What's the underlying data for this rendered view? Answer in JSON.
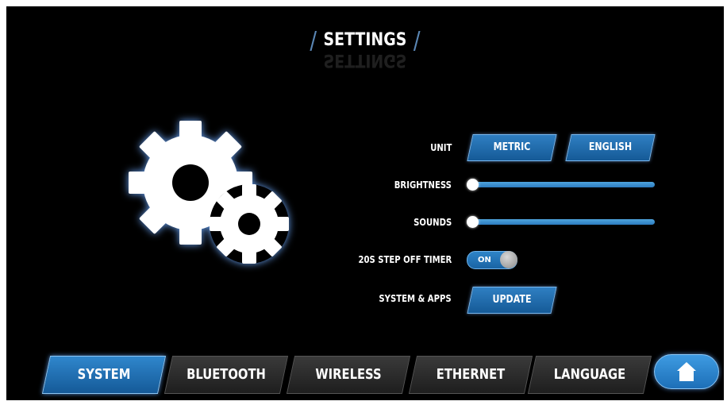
{
  "header": {
    "title": "SETTINGS"
  },
  "settings": {
    "unit": {
      "label": "UNIT",
      "options": [
        "METRIC",
        "ENGLISH"
      ],
      "selected": "METRIC"
    },
    "brightness": {
      "label": "BRIGHTNESS",
      "value": 0
    },
    "sounds": {
      "label": "SOUNDS",
      "value": 0
    },
    "step_off_timer": {
      "label": "20S STEP OFF TIMER",
      "state": "ON"
    },
    "system_apps": {
      "label": "SYSTEM & APPS",
      "button": "UPDATE"
    }
  },
  "tabs": [
    {
      "label": "SYSTEM",
      "active": true
    },
    {
      "label": "BLUETOOTH",
      "active": false
    },
    {
      "label": "WIRELESS",
      "active": false
    },
    {
      "label": "ETHERNET",
      "active": false
    },
    {
      "label": "LANGUAGE",
      "active": false
    }
  ],
  "icons": {
    "main": "gears-icon",
    "home": "home-icon"
  },
  "colors": {
    "accent": "#2f7fc2",
    "background": "#000000",
    "tab_inactive": "#2a2a2a"
  }
}
